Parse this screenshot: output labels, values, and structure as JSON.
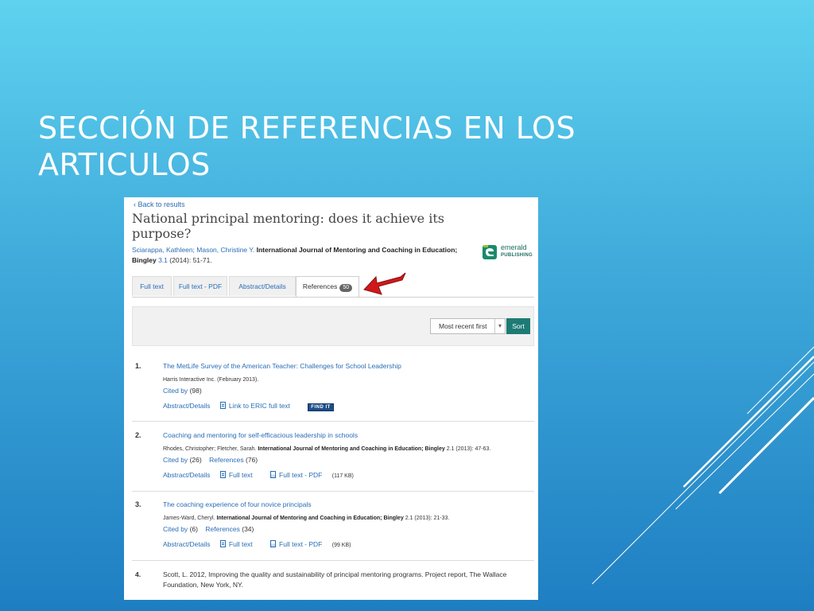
{
  "slide": {
    "title_line1": "SECCIÓN DE REFERENCIAS EN LOS",
    "title_line2": "ARTICULOS",
    "colors": {
      "accent_arrow": "#d0191b",
      "bg_top": "#5fd2ef",
      "bg_bottom": "#1e7ec2"
    }
  },
  "screenshot": {
    "back_link": "‹  Back to results",
    "article_title": "National principal mentoring: does it achieve its purpose?",
    "authors": "Sciarappa, Kathleen; Mason, Christine Y.",
    "journal": "International Journal of Mentoring and Coaching in Education;",
    "publisher_line": "Bingley",
    "issue": "3.1",
    "year_pages": "(2014): 51-71.",
    "logo": {
      "line1": "emerald",
      "line2": "PUBLISHING",
      "icon": "emerald-logo-icon"
    },
    "tabs": [
      {
        "label": "Full text"
      },
      {
        "label": "Full text - PDF"
      },
      {
        "label": "Abstract/Details"
      },
      {
        "label": "References",
        "count": "50",
        "active": true
      }
    ],
    "sort": {
      "selected": "Most recent first",
      "button": "Sort"
    },
    "references": [
      {
        "num": "1.",
        "title": "The MetLife Survey of the American Teacher: Challenges for School Leadership",
        "meta_author": "Harris Interactive Inc.",
        "meta_rest": "(February 2013).",
        "cited_label": "Cited by",
        "cited_count": "(98)",
        "link1": "Abstract/Details",
        "link2": "Link to ERIC full text",
        "badge": "FIND IT"
      },
      {
        "num": "2.",
        "title": "Coaching and mentoring for self-efficacious leadership in schools",
        "meta_author": "Rhodes, Christopher; Fletcher, Sarah.",
        "meta_journal": "International Journal of Mentoring and Coaching in Education; Bingley",
        "meta_rest": "2.1  (2013): 47-63.",
        "cited_label": "Cited by",
        "cited_count": "(26)",
        "refs_label": "References",
        "refs_count": "(76)",
        "link1": "Abstract/Details",
        "link2": "Full text",
        "link3": "Full text - PDF",
        "size": "(117 KB)"
      },
      {
        "num": "3.",
        "title": "The coaching experience of four novice principals",
        "meta_author": "James-Ward, Cheryl.",
        "meta_journal": "International Journal of Mentoring and Coaching in Education; Bingley",
        "meta_rest": "2.1  (2013): 21-33.",
        "cited_label": "Cited by",
        "cited_count": "(6)",
        "refs_label": "References",
        "refs_count": "(34)",
        "link1": "Abstract/Details",
        "link2": "Full text",
        "link3": "Full text - PDF",
        "size": "(99 KB)"
      },
      {
        "num": "4.",
        "text": "Scott, L. 2012, Improving the quality and sustainability of principal mentoring programs. Project report, The Wallace Foundation, New York, NY."
      }
    ]
  }
}
